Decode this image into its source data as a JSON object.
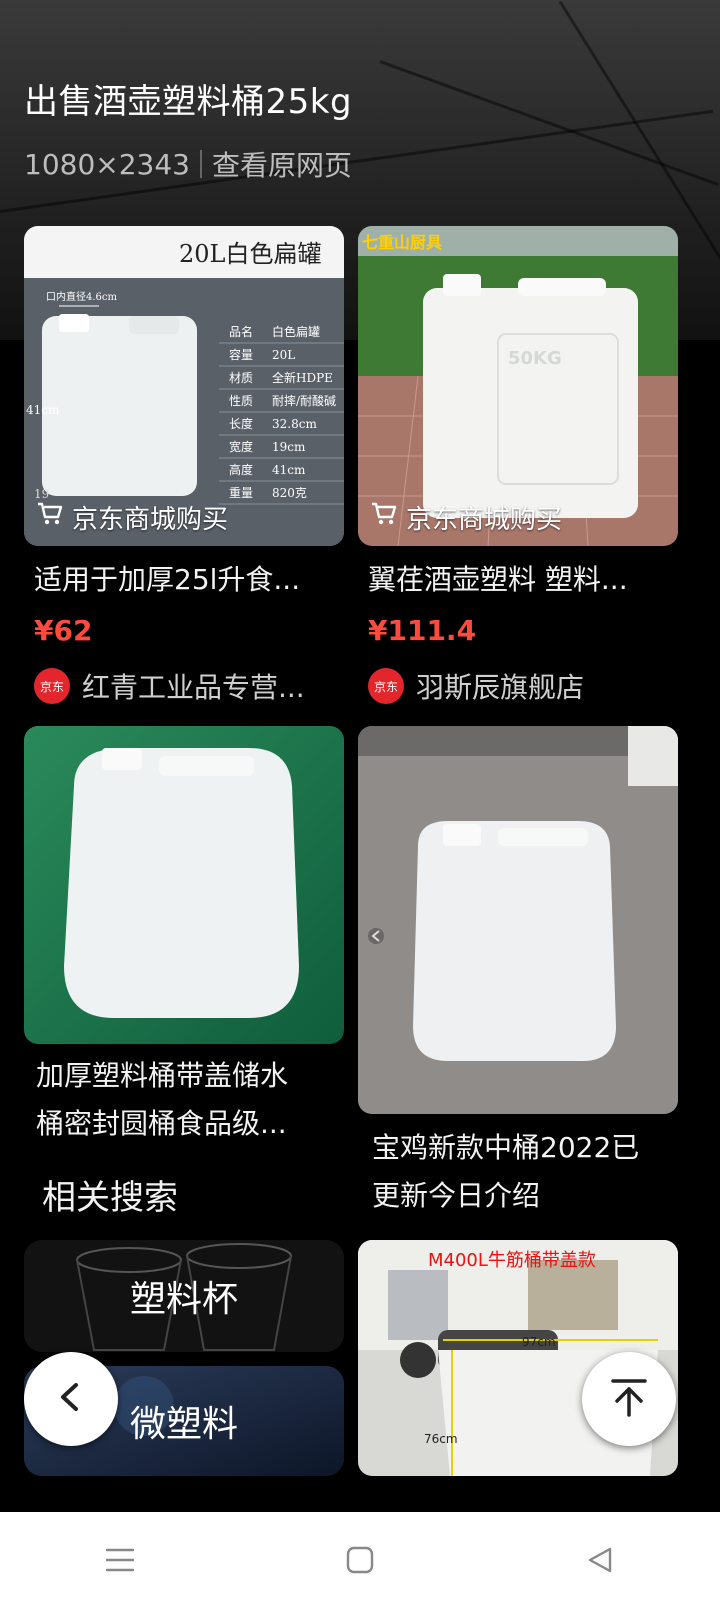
{
  "header": {
    "title": "出售酒壶塑料桶25kg",
    "dimensions": "1080×2343",
    "view_source": "查看原网页"
  },
  "products": [
    {
      "buy_label": "京东商城购买",
      "title": "适用于加厚25l升食...",
      "price": "¥62",
      "shop": "红青工业品专营...",
      "shop_logo": "京东",
      "image_text": {
        "heading": "20L白色扁罐",
        "diameter": "口内直径4.6cm",
        "height_mark": "41cm",
        "width_mark": "19",
        "spec_rows": [
          [
            "品名",
            "白色扁罐"
          ],
          [
            "容量",
            "20L"
          ],
          [
            "材质",
            "全新HDPE"
          ],
          [
            "性质",
            "耐摔/耐酸碱"
          ],
          [
            "长度",
            "32.8cm"
          ],
          [
            "宽度",
            "19cm"
          ],
          [
            "高度",
            "41cm"
          ],
          [
            "重量",
            "820克"
          ]
        ]
      }
    },
    {
      "buy_label": "京东商城购买",
      "title": "翼荏酒壶塑料 塑料...",
      "price": "¥111.4",
      "shop": "羽斯辰旗舰店",
      "shop_logo": "京东",
      "image_text": {
        "brand": "七重山厨具",
        "capacity": "50KG"
      }
    },
    {
      "title_line1": "加厚塑料桶带盖储水",
      "title_line2": "桶密封圆桶食品级..."
    },
    {
      "title_line1": "宝鸡新款中桶2022已",
      "title_line2": "更新今日介绍"
    }
  ],
  "related": {
    "title": "相关搜索",
    "items": [
      {
        "label": "塑料杯"
      },
      {
        "label": "微塑料"
      }
    ]
  },
  "promo_image": {
    "caption": "M400L牛筋桶带盖款",
    "width_mark": "97cm",
    "height_mark": "76cm"
  },
  "icons": {
    "back": "chevron-left-icon",
    "top": "arrow-up-to-top-icon",
    "cart": "cart-icon",
    "nav_menu": "menu-icon",
    "nav_home": "square-icon",
    "nav_back": "triangle-back-icon"
  },
  "colors": {
    "price": "#ff4a3d",
    "jd_red": "#e3262b",
    "background": "#000000"
  }
}
